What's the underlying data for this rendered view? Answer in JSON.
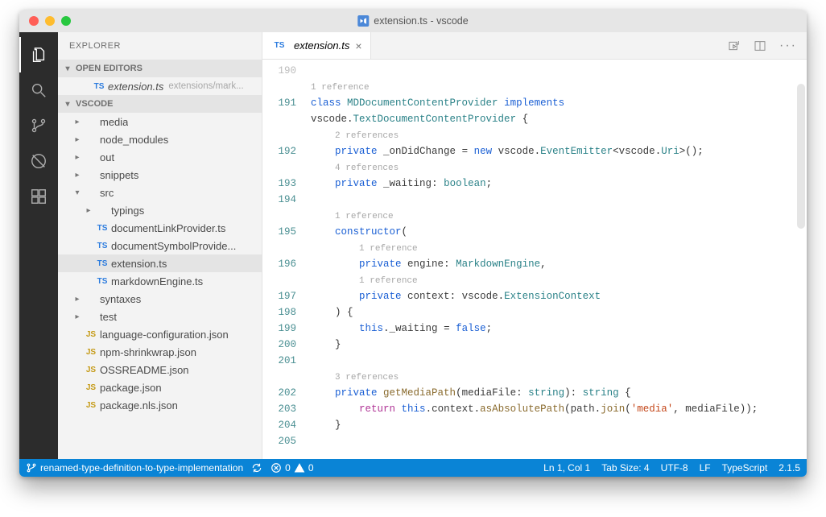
{
  "window": {
    "title": "extension.ts - vscode",
    "traffic": {
      "close": "#ff5f57",
      "min": "#febc2e",
      "max": "#28c840"
    }
  },
  "activitybar": {
    "items": [
      {
        "name": "explorer",
        "active": true
      },
      {
        "name": "search",
        "active": false
      },
      {
        "name": "scm",
        "active": false
      },
      {
        "name": "debug",
        "active": false
      },
      {
        "name": "extensions",
        "active": false
      }
    ]
  },
  "sidebar": {
    "title": "EXPLORER",
    "sections": {
      "open_editors": {
        "label": "OPEN EDITORS",
        "items": [
          {
            "icon": "TS",
            "label": "extension.ts",
            "detail": "extensions/mark...",
            "italic": true
          }
        ]
      },
      "workspace": {
        "label": "VSCODE",
        "items": [
          {
            "indent": 1,
            "twist": "fold",
            "icon": "",
            "label": "media"
          },
          {
            "indent": 1,
            "twist": "fold",
            "icon": "",
            "label": "node_modules"
          },
          {
            "indent": 1,
            "twist": "fold",
            "icon": "",
            "label": "out"
          },
          {
            "indent": 1,
            "twist": "fold",
            "icon": "",
            "label": "snippets"
          },
          {
            "indent": 1,
            "twist": "open",
            "icon": "",
            "label": "src"
          },
          {
            "indent": 2,
            "twist": "fold",
            "icon": "",
            "label": "typings"
          },
          {
            "indent": 2,
            "twist": "none",
            "icon": "TS",
            "label": "documentLinkProvider.ts"
          },
          {
            "indent": 2,
            "twist": "none",
            "icon": "TS",
            "label": "documentSymbolProvide..."
          },
          {
            "indent": 2,
            "twist": "none",
            "icon": "TS",
            "label": "extension.ts",
            "selected": true
          },
          {
            "indent": 2,
            "twist": "none",
            "icon": "TS",
            "label": "markdownEngine.ts"
          },
          {
            "indent": 1,
            "twist": "fold",
            "icon": "",
            "label": "syntaxes"
          },
          {
            "indent": 1,
            "twist": "fold",
            "icon": "",
            "label": "test"
          },
          {
            "indent": 1,
            "twist": "none",
            "icon": "JS",
            "label": "language-configuration.json"
          },
          {
            "indent": 1,
            "twist": "none",
            "icon": "JS",
            "label": "npm-shrinkwrap.json"
          },
          {
            "indent": 1,
            "twist": "none",
            "icon": "JS",
            "label": "OSSREADME.json"
          },
          {
            "indent": 1,
            "twist": "none",
            "icon": "JS",
            "label": "package.json"
          },
          {
            "indent": 1,
            "twist": "none",
            "icon": "JS",
            "label": "package.nls.json"
          }
        ]
      }
    }
  },
  "editor": {
    "tab": {
      "icon": "TS",
      "name": "extension.ts"
    },
    "gutter_top": "190",
    "lines": [
      {
        "n": "",
        "lens": "1 reference"
      },
      {
        "n": "191",
        "html": "<span class='kw'>class</span> <span class='ty'>MDDocumentContentProvider</span> <span class='kw'>implements</span>"
      },
      {
        "n": "",
        "html": "<span class='ctx'>vscode</span>.<span class='ty'>TextDocumentContentProvider</span> {"
      },
      {
        "n": "",
        "lens": "2 references",
        "indent": 1
      },
      {
        "n": "192",
        "html": "    <span class='kw'>private</span> <span class='ctx'>_onDidChange</span> = <span class='kw'>new</span> <span class='ctx'>vscode</span>.<span class='ty'>EventEmitter</span>&lt;<span class='ctx'>vscode</span>.<span class='ty'>Uri</span>&gt;();"
      },
      {
        "n": "",
        "lens": "4 references",
        "indent": 1
      },
      {
        "n": "193",
        "html": "    <span class='kw'>private</span> <span class='ctx'>_waiting</span>: <span class='ty'>boolean</span>;"
      },
      {
        "n": "194",
        "html": ""
      },
      {
        "n": "",
        "lens": "1 reference",
        "indent": 1
      },
      {
        "n": "195",
        "html": "    <span class='kw'>constructor</span>("
      },
      {
        "n": "",
        "lens": "1 reference",
        "indent": 2
      },
      {
        "n": "196",
        "html": "        <span class='kw'>private</span> <span class='ctx'>engine</span>: <span class='ty'>MarkdownEngine</span>,"
      },
      {
        "n": "",
        "lens": "1 reference",
        "indent": 2
      },
      {
        "n": "197",
        "html": "        <span class='kw'>private</span> <span class='ctx'>context</span>: <span class='ctx'>vscode</span>.<span class='ty'>ExtensionContext</span>"
      },
      {
        "n": "198",
        "html": "    ) {"
      },
      {
        "n": "199",
        "html": "        <span class='kw'>this</span>.<span class='ctx'>_waiting</span> = <span class='kw'>false</span>;"
      },
      {
        "n": "200",
        "html": "    }"
      },
      {
        "n": "201",
        "html": ""
      },
      {
        "n": "",
        "lens": "3 references",
        "indent": 1
      },
      {
        "n": "202",
        "html": "    <span class='kw'>private</span> <span class='fn'>getMediaPath</span>(<span class='ctx'>mediaFile</span>: <span class='ty'>string</span>): <span class='ty'>string</span> {"
      },
      {
        "n": "203",
        "html": "        <span class='ret'>return</span> <span class='kw'>this</span>.<span class='ctx'>context</span>.<span class='fn'>asAbsolutePath</span>(<span class='ctx'>path</span>.<span class='fn'>join</span>(<span class='str'>'media'</span>, <span class='ctx'>mediaFile</span>));"
      },
      {
        "n": "204",
        "html": "    }"
      },
      {
        "n": "205",
        "html": ""
      }
    ]
  },
  "statusbar": {
    "branch": "renamed-type-definition-to-type-implementation",
    "errors": "0",
    "warnings": "0",
    "position": "Ln 1, Col 1",
    "tabsize": "Tab Size: 4",
    "encoding": "UTF-8",
    "eol": "LF",
    "language": "TypeScript",
    "version": "2.1.5"
  }
}
